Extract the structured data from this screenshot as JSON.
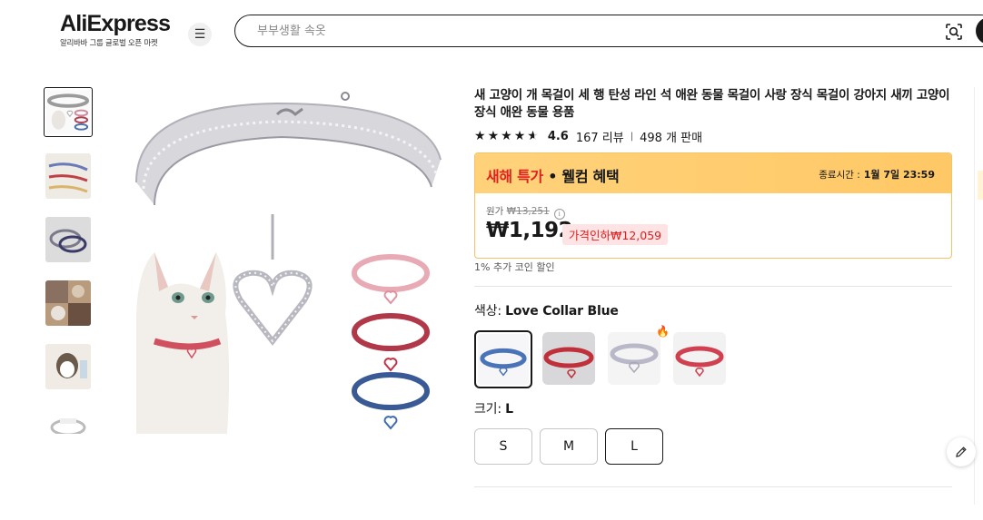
{
  "header": {
    "logo": "AliExpress",
    "logo_sub": "알리바바 그룹 글로벌 오픈 마켓",
    "menu_icon": "hamburger-menu-icon",
    "search_placeholder": "부부생활 속옷",
    "search_icons": [
      "camera-search-icon",
      "search-icon"
    ]
  },
  "gallery": {
    "thumb_count": 6,
    "active_index": 0
  },
  "product": {
    "title": "새 고양이 개 목걸이 세 행 탄성 라인 석 애완 동물 목걸이 사랑 장식 목걸이 강아지 새끼 고양이 장식 애완 동물 용품",
    "rating": "4.6",
    "stars_shown": 4.6,
    "reviews": "167 리뷰",
    "sold": "498 개 판매"
  },
  "deal": {
    "name_red": "새해 특가",
    "name_rest": " • 웰컴 혜택",
    "end_label": "종료시간 :",
    "end_time": "1월 7일 23:59",
    "orig_label": "원가",
    "orig_price": "₩13,251",
    "price": "₩1,192",
    "discount": "가격인하₩12,059",
    "coin_note": "1% 추가 코인 할인"
  },
  "color": {
    "label": "색상:",
    "value": "Love Collar Blue",
    "options": [
      {
        "name": "Love Collar Blue",
        "color": "#4a73b8"
      },
      {
        "name": "Love Collar Red",
        "color": "#c0303a"
      },
      {
        "name": "Love Collar White",
        "color": "#b8b8c8"
      },
      {
        "name": "Love Collar Pink",
        "color": "#d04050"
      }
    ],
    "selected_index": 0,
    "hot_index": 2
  },
  "size": {
    "label": "크기:",
    "value": "L",
    "options": [
      "S",
      "M",
      "L"
    ],
    "selected": "L"
  }
}
